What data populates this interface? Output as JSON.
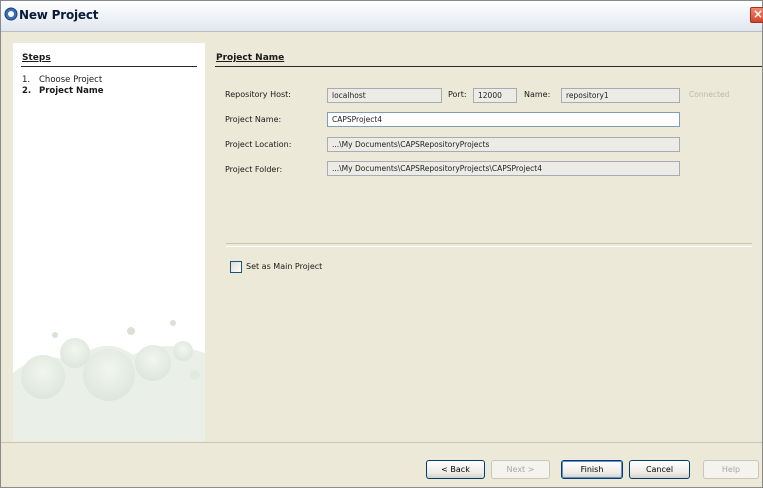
{
  "window": {
    "title": "New Project",
    "icon": "project-globe-icon",
    "close_icon": "close-icon"
  },
  "steps": {
    "title": "Steps",
    "items": [
      {
        "num": "1.",
        "label": "Choose Project",
        "current": false
      },
      {
        "num": "2.",
        "label": "Project Name",
        "current": true
      }
    ]
  },
  "main": {
    "section_title": "Project Name",
    "repository_host_label": "Repository Host:",
    "repository_host_value": "localhost",
    "port_label": "Port:",
    "port_value": "12000",
    "name_label": "Name:",
    "name_value": "repository1",
    "status": "Connected",
    "project_name_label": "Project Name:",
    "project_name_value": "CAPSProject4",
    "project_location_label": "Project Location:",
    "project_location_value": "...\\My Documents\\CAPSRepositoryProjects",
    "project_folder_label": "Project Folder:",
    "project_folder_value": "...\\My Documents\\CAPSRepositoryProjects\\CAPSProject4",
    "main_project_label": "Set as Main Project",
    "main_project_checked": false
  },
  "buttons": {
    "back": "< Back",
    "next": "Next >",
    "finish": "Finish",
    "cancel": "Cancel",
    "help": "Help"
  },
  "colors": {
    "dialog_background": "#ece9d8",
    "title_text": "#0b1a3a",
    "close_button": "#d2442b",
    "connected_text": "#b9b9b0"
  }
}
